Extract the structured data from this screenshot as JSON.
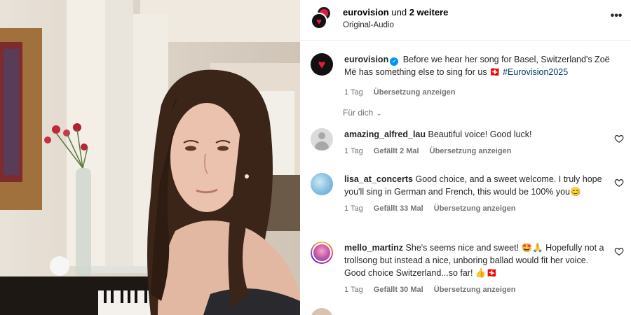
{
  "header": {
    "account": "eurovision",
    "connector": "und",
    "others": "2 weitere",
    "audio": "Original-Audio",
    "more_icon": "more-horizontal-icon"
  },
  "caption": {
    "username": "eurovision",
    "text": "Before we hear her song for Basel, Switzerland's Zoë Më has something else to sing for us 🇨🇭 ",
    "hashtag": "#Eurovision2025",
    "time": "1 Tag",
    "translate": "Übersetzung anzeigen"
  },
  "filter": {
    "label": "Für dich"
  },
  "comments": [
    {
      "username": "amazing_alfred_lau",
      "text": "Beautiful voice! Good luck!",
      "time": "1 Tag",
      "likes": "Gefällt 2 Mal",
      "translate": "Übersetzung anzeigen"
    },
    {
      "username": "lisa_at_concerts",
      "text": "Good choice, and a sweet welcome. I truly hope you'll sing in German and French, this would be 100% you😊",
      "time": "1 Tag",
      "likes": "Gefällt 33 Mal",
      "translate": "Übersetzung anzeigen"
    },
    {
      "username": "mello_martinz",
      "text": "She's seems nice and sweet! 🤩🙏 Hopefully not a trollsong but instead a nice, unboring ballad would fit her voice. Good choice Switzerland...so far! 👍🇨🇭",
      "time": "1 Tag",
      "likes": "Gefällt 30 Mal",
      "translate": "Übersetzung anzeigen"
    },
    {
      "username": "",
      "text": "",
      "time": "",
      "likes": "",
      "translate": ""
    }
  ],
  "colors": {
    "accent": "#0095f6",
    "hashtag": "#00376b",
    "muted": "#737373",
    "brand_red": "#e8193c"
  }
}
